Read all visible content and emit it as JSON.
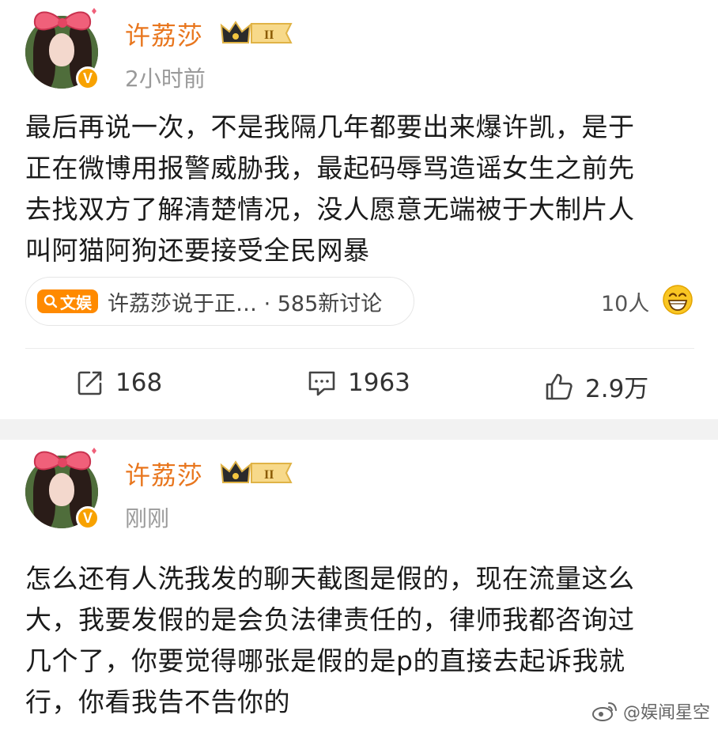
{
  "posts": [
    {
      "username": "许荔莎",
      "vip_level": "II",
      "verified_mark": "V",
      "timestamp": "2小时前",
      "content": "最后再说一次，不是我隔几年都要出来爆许凯，是于\n正在微博用报警威胁我，最起码辱骂造谣女生之前先\n去找双方了解清楚情况，没人愿意无端被于大制片人\n叫阿猫阿狗还要接受全民网暴",
      "topic": {
        "tag_label": "文娱",
        "text": "许荔莎说于正…  · 585新讨论"
      },
      "people_count": "10人",
      "actions": {
        "repost": "168",
        "comment": "1963",
        "like": "2.9万"
      }
    },
    {
      "username": "许荔莎",
      "vip_level": "II",
      "verified_mark": "V",
      "timestamp": "刚刚",
      "content": "怎么还有人洗我发的聊天截图是假的，现在流量这么\n大，我要发假的是会负法律责任的，律师我都咨询过\n几个了，你要觉得哪张是假的是p的直接去起诉我就\n行，你看我告不告你的"
    }
  ],
  "watermark": "@娱闻星空",
  "colors": {
    "username": "#e8761e",
    "verified": "#f8a200",
    "topic_tag": "#ff8a00",
    "separator": "#f2f2f2"
  },
  "icons": [
    "repost-icon",
    "comment-icon",
    "like-icon",
    "weibo-logo-icon",
    "grin-emoji-icon",
    "search-icon"
  ]
}
